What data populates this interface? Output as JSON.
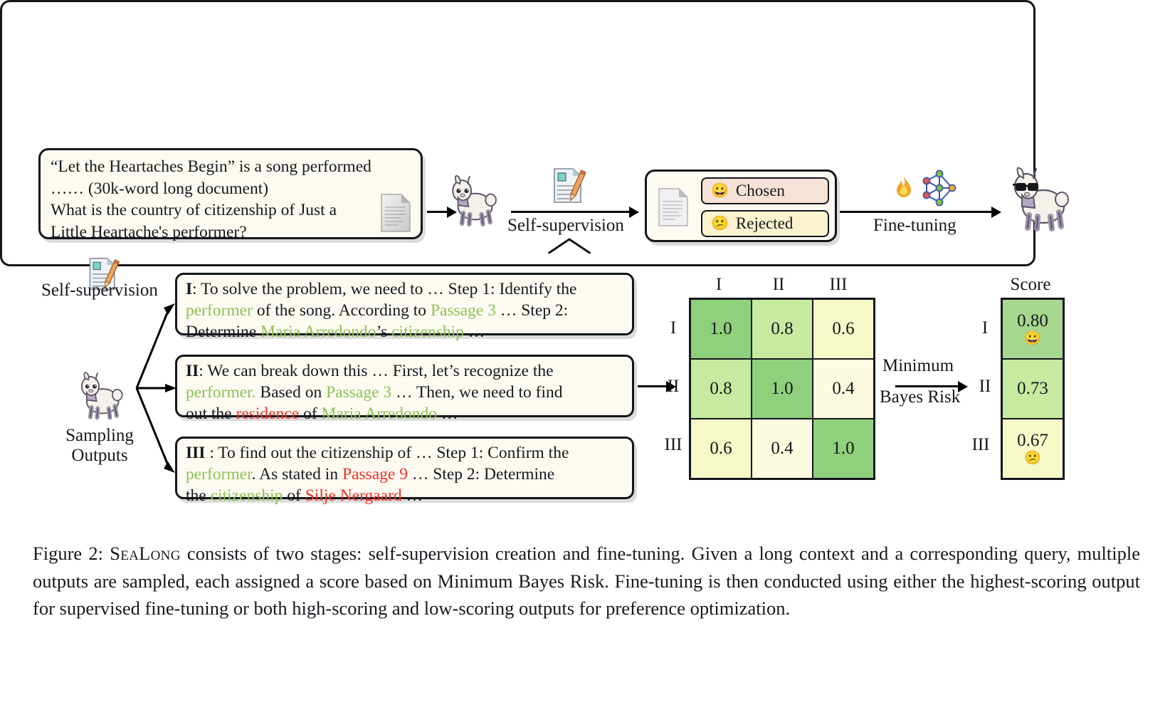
{
  "figure": {
    "caption_prefix": "Figure 2:",
    "caption_name": "SeaLong",
    "caption_body": " consists of two stages: self-supervision creation and fine-tuning. Given a long context and a corresponding query, multiple outputs are sampled, each assigned a score based on Minimum Bayes Risk. Fine-tuning is then conducted using either the highest-scoring output for supervised fine-tuning or both high-scoring and low-scoring outputs for preference optimization."
  },
  "query_box": {
    "lines": [
      "“Let the Heartaches Begin” is a song performed",
      " …… (30k-word long document)",
      "What is the country of citizenship of Just a",
      "Little Heartache's performer?"
    ],
    "doc_icon": "document-icon"
  },
  "pipeline": {
    "self_supervision_label": "Self-supervision",
    "fine_tuning_label": "Fine-tuning",
    "base_model_icon": "llama-icon",
    "tuned_model_icon": "llama-sunglasses-icon",
    "writing_icon": "memo-pencil-icon",
    "fire_icon": "fire-icon",
    "network_icon": "neural-network-icon"
  },
  "pair_box": {
    "doc_icon": "document-icon",
    "chosen": {
      "label": "Chosen",
      "emoji": "😀",
      "color": "#f6e2d6"
    },
    "rejected": {
      "label": "Rejected",
      "emoji": "😕",
      "color": "#fbf3cd"
    }
  },
  "detail": {
    "self_supervision_label": "Self-supervision",
    "sampling_label_line1": "Sampling",
    "sampling_label_line2": "Outputs",
    "mbr_label_line1": "Minimum",
    "mbr_label_line2": "Bayes Risk",
    "outputs": [
      {
        "roman": "I",
        "segments": [
          [
            {
              "t": "I",
              "c": "rom"
            },
            {
              "t": ": To solve the problem, we need to … Step 1: Identify the",
              "c": ""
            }
          ],
          [
            {
              "t": "performer",
              "c": "g"
            },
            {
              "t": " of the song. According to ",
              "c": ""
            },
            {
              "t": "Passage 3",
              "c": "g"
            },
            {
              "t": " … Step 2:",
              "c": ""
            }
          ],
          [
            {
              "t": "Determine ",
              "c": ""
            },
            {
              "t": "Maria Arredondo",
              "c": "g"
            },
            {
              "t": "’s ",
              "c": ""
            },
            {
              "t": "citizenship",
              "c": "g"
            },
            {
              "t": " …",
              "c": ""
            }
          ]
        ]
      },
      {
        "roman": "II",
        "segments": [
          [
            {
              "t": "II",
              "c": "rom"
            },
            {
              "t": ": We can break down this …  First, let’s recognize the",
              "c": ""
            }
          ],
          [
            {
              "t": "performer.",
              "c": "g"
            },
            {
              "t": " Based on ",
              "c": ""
            },
            {
              "t": "Passage 3",
              "c": "g"
            },
            {
              "t": " … Then, we need to find",
              "c": ""
            }
          ],
          [
            {
              "t": "out the ",
              "c": ""
            },
            {
              "t": "residence",
              "c": "r"
            },
            {
              "t": " of ",
              "c": ""
            },
            {
              "t": "Maria Arredondo",
              "c": "g"
            },
            {
              "t": " …",
              "c": ""
            }
          ]
        ]
      },
      {
        "roman": "III",
        "segments": [
          [
            {
              "t": "III",
              "c": "rom"
            },
            {
              "t": " : To find out the citizenship of … Step 1: Confirm the",
              "c": ""
            }
          ],
          [
            {
              "t": "performer",
              "c": "g"
            },
            {
              "t": ". As stated in ",
              "c": ""
            },
            {
              "t": "Passage 9",
              "c": "r"
            },
            {
              "t": " … Step 2: Determine",
              "c": ""
            }
          ],
          [
            {
              "t": "the ",
              "c": ""
            },
            {
              "t": "citizenship",
              "c": "g"
            },
            {
              "t": " of ",
              "c": ""
            },
            {
              "t": "Silje Nergaard",
              "c": "r"
            },
            {
              "t": " …",
              "c": ""
            }
          ]
        ]
      }
    ]
  },
  "colors": {
    "high": "#8fd07c",
    "mid": "#c6ea9f",
    "low": "#f7f8c8",
    "lowest": "#fdfbdf",
    "green_text": "#8cc252",
    "red_text": "#ef3124",
    "panel_bg": "#fdfaf2",
    "chosen_bg": "#f6e2d6",
    "rejected_bg": "#fbf3cd"
  },
  "chart_data": {
    "type": "heatmap",
    "title": "",
    "row_labels": [
      "I",
      "II",
      "III"
    ],
    "col_labels": [
      "I",
      "II",
      "III"
    ],
    "values": [
      [
        1.0,
        0.8,
        0.6
      ],
      [
        0.8,
        1.0,
        0.4
      ],
      [
        0.6,
        0.4,
        1.0
      ]
    ],
    "cell_text": [
      [
        "1.0",
        "0.8",
        "0.6"
      ],
      [
        "0.8",
        "1.0",
        "0.4"
      ],
      [
        "0.6",
        "0.4",
        "1.0"
      ]
    ],
    "cell_colors": [
      [
        "#8fd07c",
        "#c6ea9f",
        "#f7f8c8"
      ],
      [
        "#c6ea9f",
        "#8fd07c",
        "#fdfbdf"
      ],
      [
        "#f7f8c8",
        "#fdfbdf",
        "#8fd07c"
      ]
    ],
    "score_header": "Score",
    "score_rows": [
      {
        "label": "I",
        "value": "0.80",
        "emoji": "😀",
        "color": "#a7d68f"
      },
      {
        "label": "II",
        "value": "0.73",
        "emoji": "",
        "color": "#c6ea9f"
      },
      {
        "label": "III",
        "value": "0.67",
        "emoji": "😕",
        "color": "#f7f8c8"
      }
    ],
    "scores_numeric": [
      0.8,
      0.73,
      0.67
    ],
    "annotation": "Minimum Bayes Risk",
    "grid": true,
    "legend": "none"
  }
}
